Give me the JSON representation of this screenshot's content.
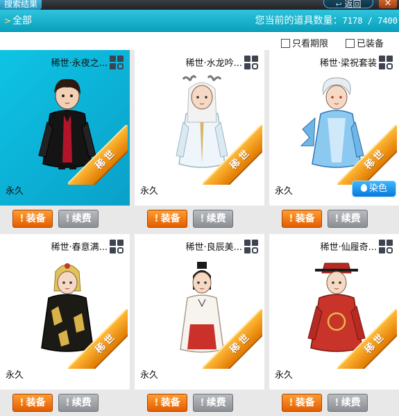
{
  "titlebar": {
    "tab_label": "搜索结果",
    "back_label": "返回",
    "close_label": "×"
  },
  "catbar": {
    "category_label": "全部",
    "count_label": "您当前的道具数量：",
    "count_value": "7178 / 7400"
  },
  "filters": {
    "only_timed_label": "只看期限",
    "equipped_label": "已装备"
  },
  "rare_badge_label": "稀世",
  "equip_label": "装备",
  "renew_label": "续费",
  "dye_label": "染色",
  "items": [
    {
      "name": "稀世·永夜之...",
      "duration": "永久",
      "selected": true
    },
    {
      "name": "稀世·水龙吟...",
      "duration": "永久"
    },
    {
      "name": "稀世·梁祝套装",
      "duration": "永久",
      "dye": true
    },
    {
      "name": "稀世·春意满...",
      "duration": "永久"
    },
    {
      "name": "稀世·良辰美...",
      "duration": "永久"
    },
    {
      "name": "稀世·仙履奇...",
      "duration": "永久"
    }
  ]
}
